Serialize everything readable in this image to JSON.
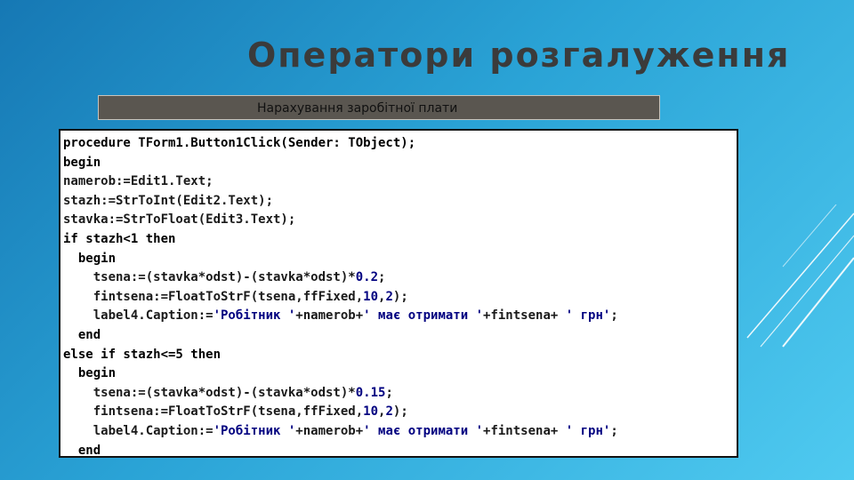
{
  "slide": {
    "title": "Оператори розгалуження",
    "caption": "Нарахування заробітної плати"
  },
  "code": {
    "lines": [
      [
        {
          "t": "procedure TForm1.Button1Click(Sender: TObject);",
          "c": "kw"
        }
      ],
      [
        {
          "t": "begin",
          "c": "kw"
        }
      ],
      [
        {
          "t": "namerob:=Edit1.Text;",
          "c": ""
        }
      ],
      [
        {
          "t": "stazh:=StrToInt(Edit2.Text);",
          "c": ""
        }
      ],
      [
        {
          "t": "stavka:=StrToFloat(Edit3.Text);",
          "c": ""
        }
      ],
      [
        {
          "t": "if stazh<1 then",
          "c": "kw"
        }
      ],
      [
        {
          "t": "  begin",
          "c": "kw"
        }
      ],
      [
        {
          "t": "    tsena:=(stavka*odst)-(stavka*odst)*",
          "c": ""
        },
        {
          "t": "0.2",
          "c": "num"
        },
        {
          "t": ";",
          "c": ""
        }
      ],
      [
        {
          "t": "    fintsena:=FloatToStrF(tsena,ffFixed,",
          "c": ""
        },
        {
          "t": "10",
          "c": "num"
        },
        {
          "t": ",",
          "c": ""
        },
        {
          "t": "2",
          "c": "num"
        },
        {
          "t": ");",
          "c": ""
        }
      ],
      [
        {
          "t": "    label4.Caption:=",
          "c": ""
        },
        {
          "t": "'Робітник '",
          "c": "str"
        },
        {
          "t": "+namerob+",
          "c": ""
        },
        {
          "t": "' має отримати '",
          "c": "str"
        },
        {
          "t": "+fintsena+ ",
          "c": ""
        },
        {
          "t": "' грн'",
          "c": "str"
        },
        {
          "t": ";",
          "c": ""
        }
      ],
      [
        {
          "t": "  end",
          "c": "kw"
        }
      ],
      [
        {
          "t": "else if stazh<=5 then",
          "c": "kw"
        }
      ],
      [
        {
          "t": "  begin",
          "c": "kw"
        }
      ],
      [
        {
          "t": "    tsena:=(stavka*odst)-(stavka*odst)*",
          "c": ""
        },
        {
          "t": "0.15",
          "c": "num"
        },
        {
          "t": ";",
          "c": ""
        }
      ],
      [
        {
          "t": "    fintsena:=FloatToStrF(tsena,ffFixed,",
          "c": ""
        },
        {
          "t": "10",
          "c": "num"
        },
        {
          "t": ",",
          "c": ""
        },
        {
          "t": "2",
          "c": "num"
        },
        {
          "t": ");",
          "c": ""
        }
      ],
      [
        {
          "t": "    label4.Caption:=",
          "c": ""
        },
        {
          "t": "'Робітник '",
          "c": "str"
        },
        {
          "t": "+namerob+",
          "c": ""
        },
        {
          "t": "' має отримати '",
          "c": "str"
        },
        {
          "t": "+fintsena+ ",
          "c": ""
        },
        {
          "t": "' грн'",
          "c": "str"
        },
        {
          "t": ";",
          "c": ""
        }
      ],
      [
        {
          "t": "  end",
          "c": "kw"
        }
      ]
    ]
  },
  "colors": {
    "background_start": "#1678b4",
    "background_end": "#4fcaf0",
    "title": "#3b3b3b",
    "caption_bar": "#5a5650"
  }
}
